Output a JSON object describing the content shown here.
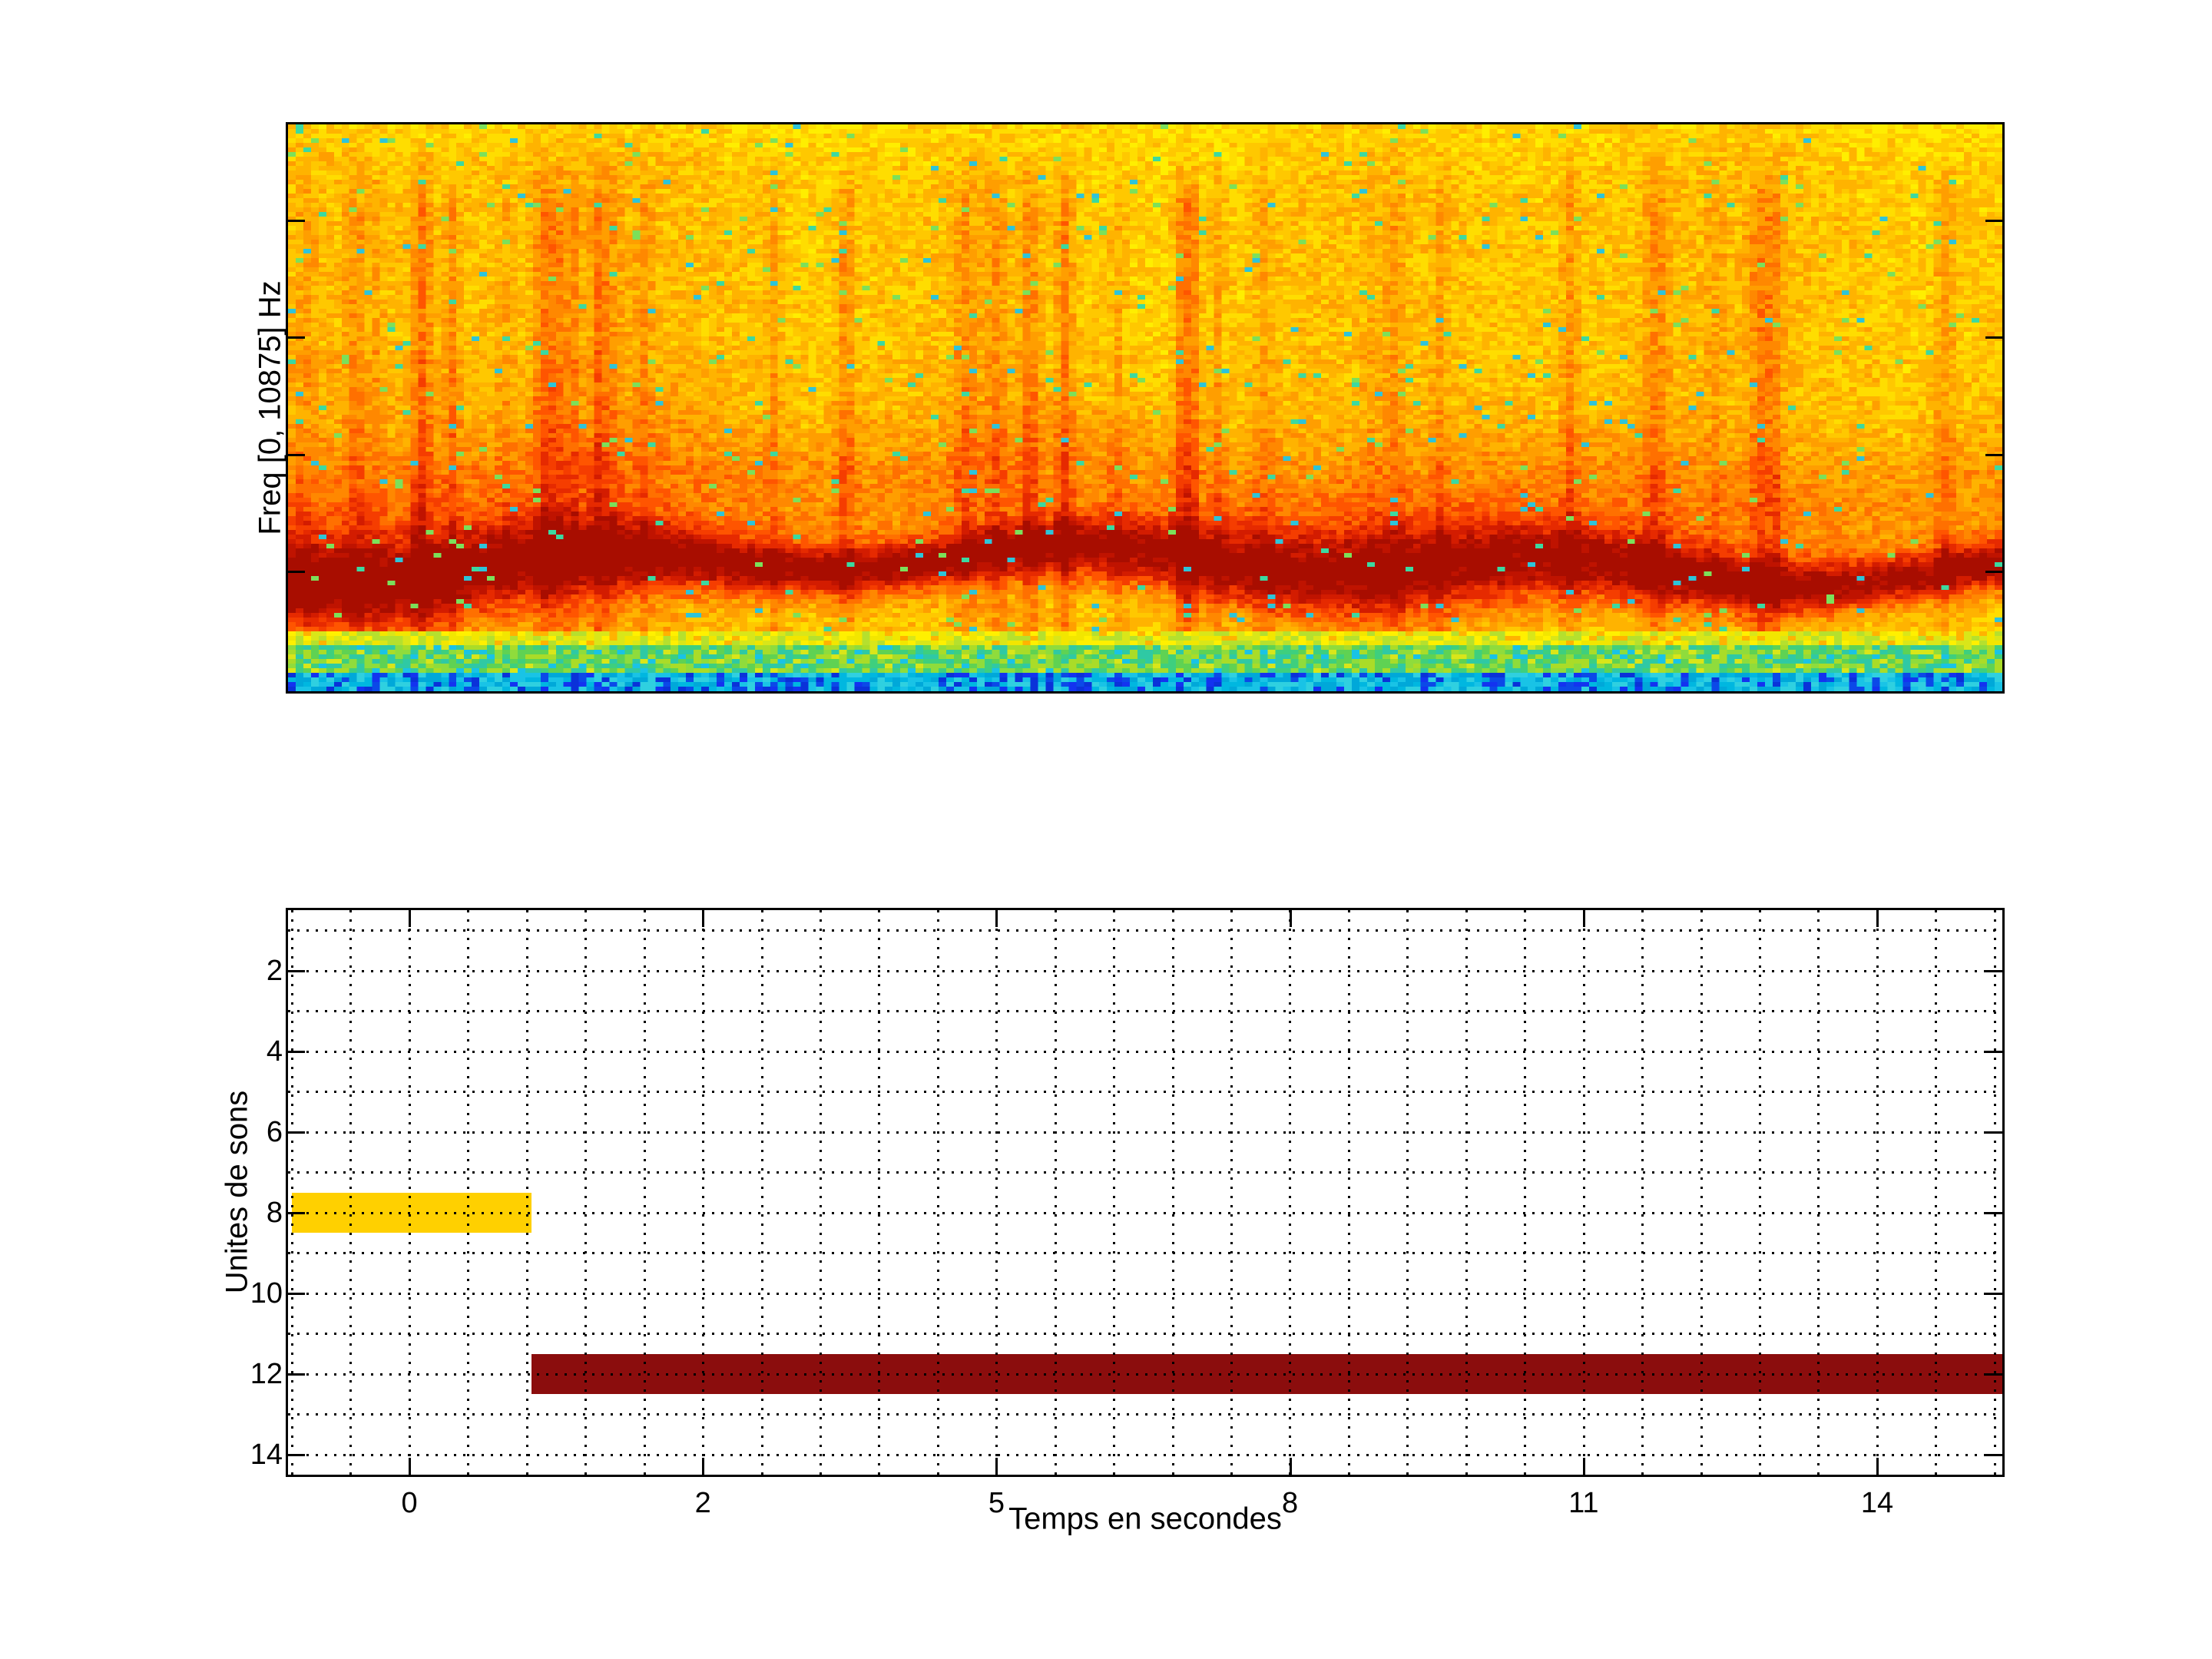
{
  "figure": {
    "background": "#ffffff",
    "kind": "matlab-style figure with two subplots"
  },
  "chart_data": [
    {
      "type": "heatmap",
      "name": "audio-spectrogram",
      "title": "",
      "xlabel": "",
      "ylabel": "Freq [0, 10875] Hz",
      "freq_range_hz": [
        0,
        10875
      ],
      "colormap": "jet",
      "x_tick_labels": [],
      "y_tick_labels": [],
      "description": "Dense noisy spectrogram: yellow-orange noise field with vertical red streaks, a strong dark-red energy band in the lower third, then a bright yellow transition, a green speckled band and a cyan strip with dark blue vertical dashes at the bottom.",
      "palette_ramp": [
        "#ffee00",
        "#ffdd00",
        "#ffc800",
        "#ffb300",
        "#ff9e00",
        "#ff8800",
        "#ff7000",
        "#ff5500",
        "#f53d00",
        "#e62a00",
        "#d31c00",
        "#bf1300",
        "#a80d00"
      ],
      "speck_colors": [
        "#7ce05a",
        "#3cd9a0",
        "#2ec4d9"
      ],
      "transition_colors": [
        "#fff000",
        "#f2e600",
        "#d9e619",
        "#b5e02e"
      ],
      "green_colors": [
        "#8fdc3c",
        "#5fd253",
        "#3ecf7e",
        "#2fc9a4",
        "#aadc28"
      ],
      "cyan_colors": [
        "#19c3e6",
        "#00b7e0",
        "#2fd0e0",
        "#00a8d9"
      ],
      "blue_dash_colors": [
        "#0a32d9",
        "#1333f0",
        "#0b49e8"
      ],
      "bands": [
        {
          "region": "upper noise field",
          "t_span": [
            0.0,
            0.88
          ]
        },
        {
          "region": "red energy band",
          "t_span": [
            0.7,
            0.87
          ]
        },
        {
          "region": "yellow transition",
          "t_span": [
            0.898,
            0.9255
          ]
        },
        {
          "region": "green band",
          "t_span": [
            0.9255,
            0.9688
          ]
        },
        {
          "region": "cyan strip",
          "t_span": [
            0.9688,
            1.0
          ]
        }
      ]
    },
    {
      "type": "bar",
      "name": "sound-units-timeline",
      "orientation": "horizontal",
      "xlabel": "Temps en secondes",
      "ylabel": "Unites de sons",
      "x_tick_labels": [
        "0",
        "2",
        "5",
        "8",
        "11",
        "14"
      ],
      "y_tick_labels": [
        "2",
        "4",
        "6",
        "8",
        "10",
        "12",
        "14"
      ],
      "y_range": [
        0.5,
        14.5
      ],
      "y_direction": "down",
      "grid": "dotted",
      "bars": [
        {
          "unit": 8,
          "start_s": -0.8,
          "end_s": 0.83,
          "color": "#ffd000"
        },
        {
          "unit": 12,
          "start_s": 0.83,
          "end_s": 15.3,
          "color": "#8b0d0d"
        }
      ]
    }
  ]
}
